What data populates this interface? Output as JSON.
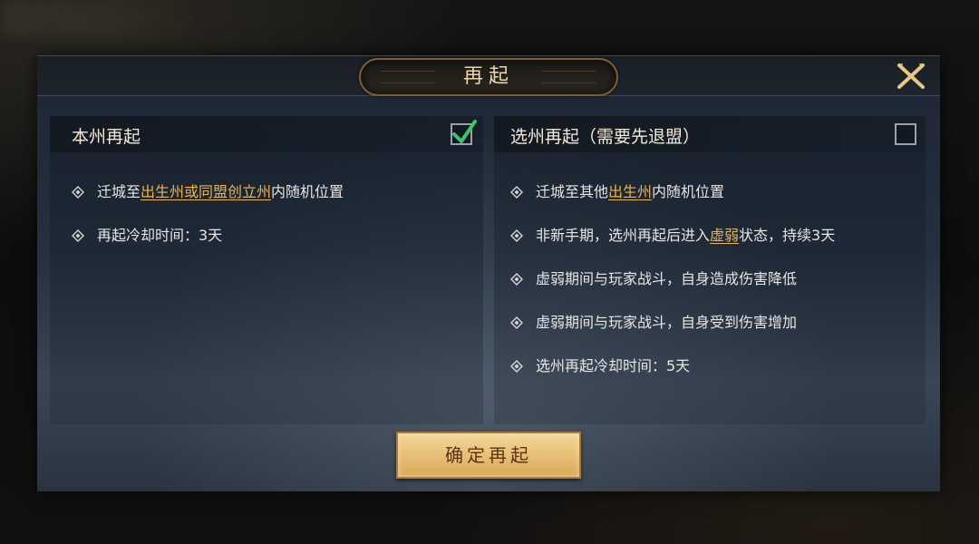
{
  "dialog": {
    "title": "再起",
    "confirm_label": "确定再起"
  },
  "left_option": {
    "title": "本州再起",
    "checked": true,
    "lines": [
      {
        "prefix": "迁城至",
        "link": "出生州或同盟创立州",
        "suffix": "内随机位置"
      },
      {
        "text": "再起冷却时间：3天"
      }
    ]
  },
  "right_option": {
    "title": "选州再起（需要先退盟）",
    "checked": false,
    "lines": [
      {
        "prefix": "迁城至其他",
        "link": "出生州",
        "suffix": "内随机位置"
      },
      {
        "prefix": "非新手期，选州再起后进入",
        "link": "虚弱",
        "suffix": "状态，持续3天"
      },
      {
        "text": "虚弱期间与玩家战斗，自身造成伤害降低"
      },
      {
        "text": "虚弱期间与玩家战斗，自身受到伤害增加"
      },
      {
        "text": "选州再起冷却时间：5天"
      }
    ]
  },
  "icons": {
    "close": "close-x-icon",
    "check": "checkmark-icon",
    "bullet": "diamond-bullet-icon"
  },
  "colors": {
    "highlight": "#f0b44a",
    "check": "#3ec46a",
    "gold": "#e8c27a"
  }
}
